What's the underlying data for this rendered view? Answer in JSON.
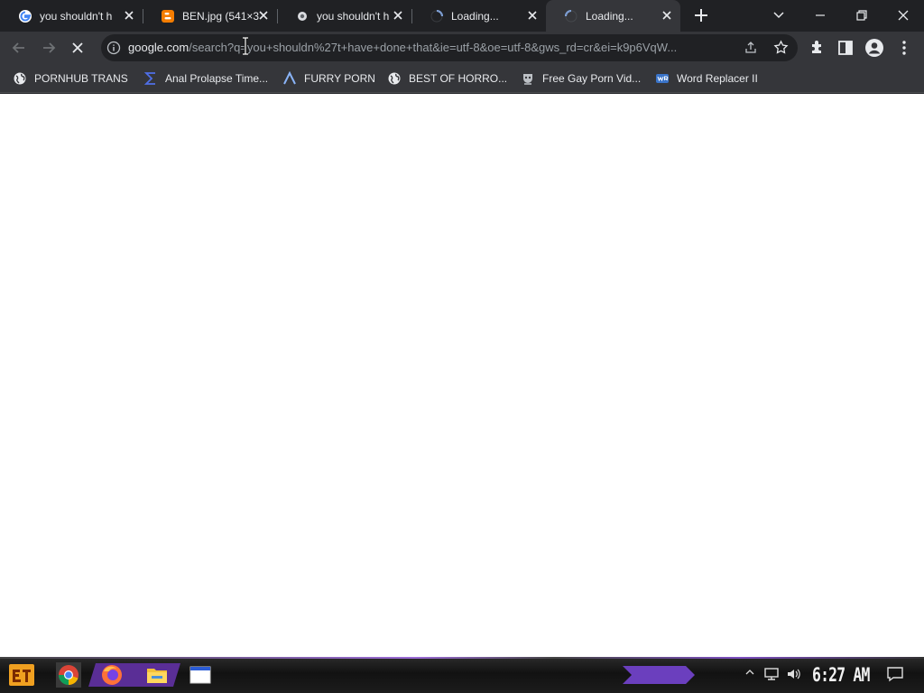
{
  "tabs": [
    {
      "title": "you shouldn't h",
      "icon": "google-icon"
    },
    {
      "title": "BEN.jpg (541×3",
      "icon": "blogger-icon"
    },
    {
      "title": "you shouldn't h",
      "icon": "site-icon"
    },
    {
      "title": "Loading...",
      "icon": "spinner-icon"
    },
    {
      "title": "Loading...",
      "icon": "spinner-icon",
      "active": true
    }
  ],
  "toolbar": {
    "url_host": "google.com",
    "url_path": "/search?q=you+shouldn%27t+have+done+that&ie=utf-8&oe=utf-8&gws_rd=cr&ei=k9p6VqW..."
  },
  "bookmarks": [
    {
      "label": "PORNHUB TRANS",
      "icon": "globe-icon"
    },
    {
      "label": "Anal Prolapse Time...",
      "icon": "sigma-icon"
    },
    {
      "label": "FURRY PORN",
      "icon": "lambda-icon"
    },
    {
      "label": "BEST OF HORRO...",
      "icon": "globe-icon"
    },
    {
      "label": "Free Gay Porn Vid...",
      "icon": "mask-icon"
    },
    {
      "label": "Word Replacer II",
      "icon": "wr-icon"
    }
  ],
  "taskbar": {
    "clock": "6:27 AM"
  },
  "colors": {
    "titlebar": "#202124",
    "toolbar": "#35363a",
    "accent_purple": "#8a4fd6"
  }
}
